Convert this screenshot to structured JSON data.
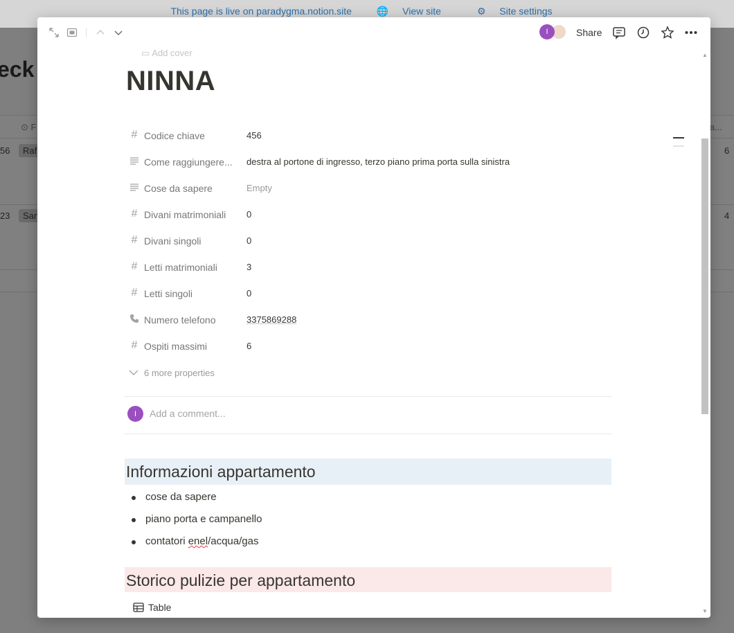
{
  "background": {
    "banner": {
      "live_text": "This page is live on paradygma.notion.site",
      "view_site": "View site",
      "site_settings": "Site settings"
    },
    "title_fragment": "eck",
    "rows": [
      {
        "num": "56",
        "chip": "Raf",
        "right": "6"
      },
      {
        "num": "23",
        "chip": "San",
        "right": "4"
      }
    ],
    "header_right": "ma..."
  },
  "topbar": {
    "share_label": "Share",
    "avatar_initial": "I"
  },
  "page": {
    "add_cover": "Add cover",
    "title": "NINNA",
    "properties": [
      {
        "icon": "number",
        "name": "Codice chiave",
        "value": "456"
      },
      {
        "icon": "text",
        "name": "Come raggiungere...",
        "value": "destra al portone di ingresso, terzo piano prima porta sulla sinistra"
      },
      {
        "icon": "text",
        "name": "Cose da sapere",
        "value": "Empty"
      },
      {
        "icon": "number",
        "name": "Divani matrimoniali",
        "value": "0"
      },
      {
        "icon": "number",
        "name": "Divani singoli",
        "value": "0"
      },
      {
        "icon": "number",
        "name": "Letti matrimoniali",
        "value": "3"
      },
      {
        "icon": "number",
        "name": "Letti singoli",
        "value": "0"
      },
      {
        "icon": "phone",
        "name": "Numero telefono",
        "value": "3375869288"
      },
      {
        "icon": "number",
        "name": "Ospiti massimi",
        "value": "6"
      }
    ],
    "more_properties": "6 more properties",
    "comment_placeholder": "Add a comment...",
    "comment_avatar": "I",
    "section1": {
      "heading": "Informazioni appartamento",
      "items": [
        "cose da sapere",
        "piano porta e campanello",
        "contatori enel/acqua/gas"
      ]
    },
    "section2": {
      "heading": "Storico pulizie per appartamento"
    },
    "table_view_label": "Table"
  },
  "colors": {
    "avatar_purple": "#9a4fbf",
    "heading_blue_bg": "#e7f0f7",
    "heading_pink_bg": "#fbe8e8",
    "banner_link": "#2f6fa8"
  }
}
